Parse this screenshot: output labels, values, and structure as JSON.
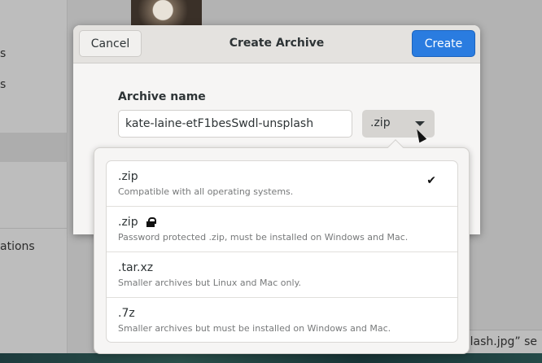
{
  "sidebar": {
    "items": [
      "s",
      "s",
      "ations"
    ]
  },
  "status_text": "nsplash.jpg” se",
  "dialog": {
    "title": "Create Archive",
    "cancel_label": "Cancel",
    "create_label": "Create",
    "archive_name_label": "Archive name",
    "archive_name_value": "kate-laine-etF1besSwdl-unsplash",
    "format_selected": ".zip"
  },
  "formats": [
    {
      "name": ".zip",
      "desc": "Compatible with all operating systems.",
      "selected": true
    },
    {
      "name": ".zip",
      "desc": "Password protected .zip, must be installed on Windows and Mac.",
      "locked": true
    },
    {
      "name": ".tar.xz",
      "desc": "Smaller archives but Linux and Mac only."
    },
    {
      "name": ".7z",
      "desc": "Smaller archives but must be installed on Windows and Mac."
    }
  ],
  "colors": {
    "accent": "#2a7ce0"
  }
}
